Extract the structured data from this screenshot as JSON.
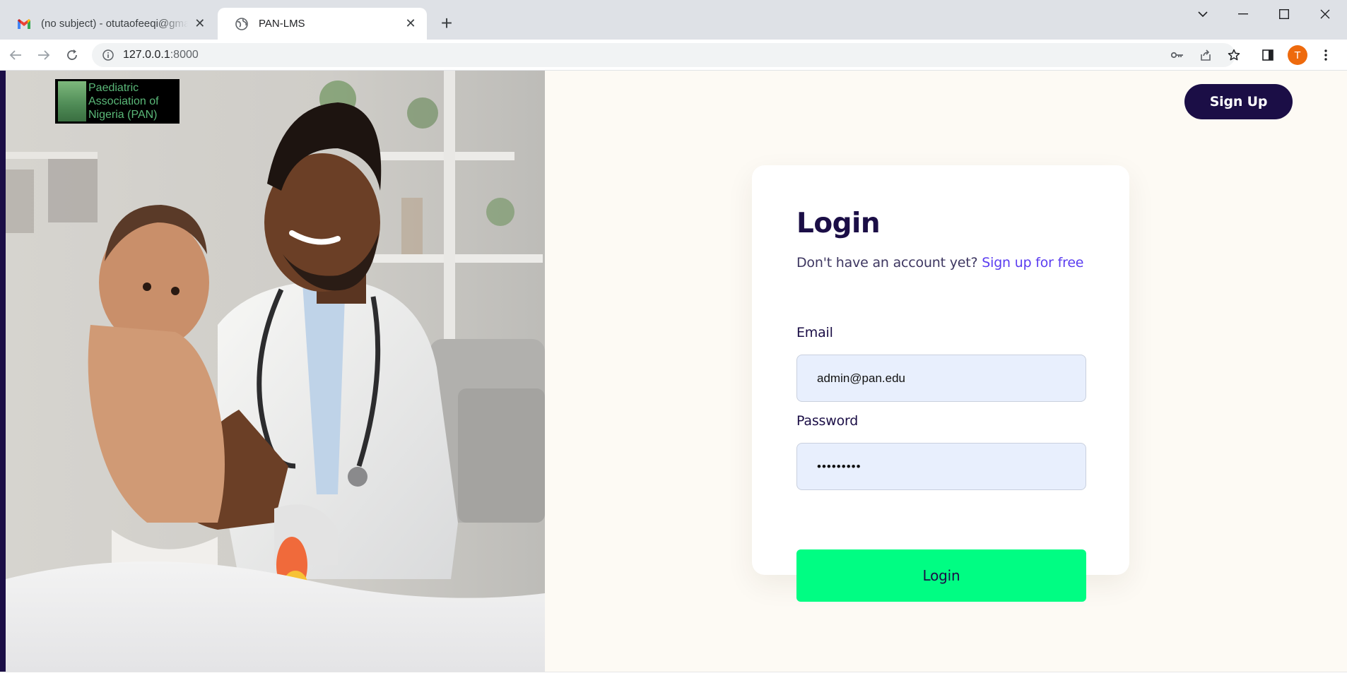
{
  "browser": {
    "tabs": [
      {
        "title": "(no subject) - otutaofeeqi@gmail.com",
        "favicon": "gmail-icon",
        "active": false
      },
      {
        "title": "PAN-LMS",
        "favicon": "globe-icon",
        "active": true
      }
    ],
    "url_host": "127.0.0.1",
    "url_port": ":8000",
    "profile_initial": "T",
    "profile_color": "#ee6a0d"
  },
  "page": {
    "logo": {
      "lines": [
        "Paediatric",
        "Association of",
        "Nigeria (PAN)"
      ]
    },
    "signup_button": "Sign Up",
    "login_card": {
      "title": "Login",
      "subtitle": "Don't have an account yet?",
      "signup_link": "Sign up for free",
      "email_label": "Email",
      "email_value": "admin@pan.edu",
      "password_label": "Password",
      "password_value": "•••••••••",
      "submit_label": "Login"
    },
    "colors": {
      "brand_dark": "#1b0e46",
      "accent_green": "#00fd83",
      "link_purple": "#5b3df0",
      "background": "#fdfaf4",
      "input_bg": "#e8effd"
    }
  }
}
